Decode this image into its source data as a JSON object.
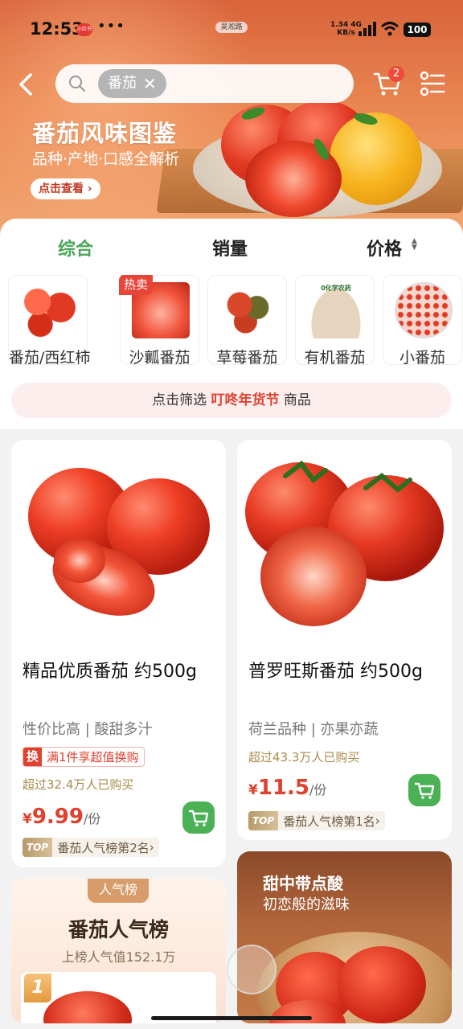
{
  "status_bar": {
    "time": "12:53",
    "app_badge": "小红书",
    "dots": "•••",
    "notch_label": "吴淞路",
    "net_speed": "1.34",
    "net_type": "4G",
    "net_unit": "KB/s",
    "battery": "100"
  },
  "header": {
    "search_chip": "番茄",
    "chip_close": "✕",
    "cart_count": "2"
  },
  "hero": {
    "title": "番茄风味图鉴",
    "subtitle": "品种·产地·口感全解析",
    "button": "点击查看",
    "button_arrow": "›"
  },
  "sort_tabs": [
    {
      "label": "综合",
      "active": true
    },
    {
      "label": "销量",
      "active": false
    },
    {
      "label": "价格",
      "active": false
    }
  ],
  "categories": [
    {
      "label": "番茄/西红柿",
      "badge": ""
    },
    {
      "label": "沙瓤番茄",
      "badge": "热卖"
    },
    {
      "label": "草莓番茄",
      "badge": ""
    },
    {
      "label": "有机番茄",
      "badge": "",
      "img_text": "0化学农药"
    },
    {
      "label": "小番茄",
      "badge": ""
    }
  ],
  "filter_bar": {
    "prefix": "点击筛选",
    "highlight": "叮咚年货节",
    "suffix": "商品"
  },
  "products": [
    {
      "title": "精品优质番茄 约500g",
      "subtitle": "性价比高 | 酸甜多汁",
      "promo_tag": "换",
      "promo_text": "满1件享超值换购",
      "sold": "超过32.4万人已购买",
      "currency": "¥",
      "price": "9.99",
      "unit": "/份",
      "rank_badge": "TOP",
      "rank_text": "番茄人气榜第2名",
      "rank_arrow": "›"
    },
    {
      "title": "普罗旺斯番茄 约500g",
      "subtitle": "荷兰品种 | 亦果亦蔬",
      "sold": "超过43.3万人已购买",
      "currency": "¥",
      "price": "11.5",
      "unit": "/份",
      "rank_badge": "TOP",
      "rank_text": "番茄人气榜第1名",
      "rank_arrow": "›"
    }
  ],
  "leaderboard": {
    "ribbon": "人气榜",
    "title": "番茄人气榜",
    "subtitle": "上榜人气值152.1万",
    "rank_num": "1"
  },
  "promo_card": {
    "line1": "甜中带点酸",
    "line2": "初恋般的滋味"
  },
  "colors": {
    "accent_green": "#4aa65a",
    "price_red": "#e0402e",
    "cart_green": "#4ab254"
  }
}
